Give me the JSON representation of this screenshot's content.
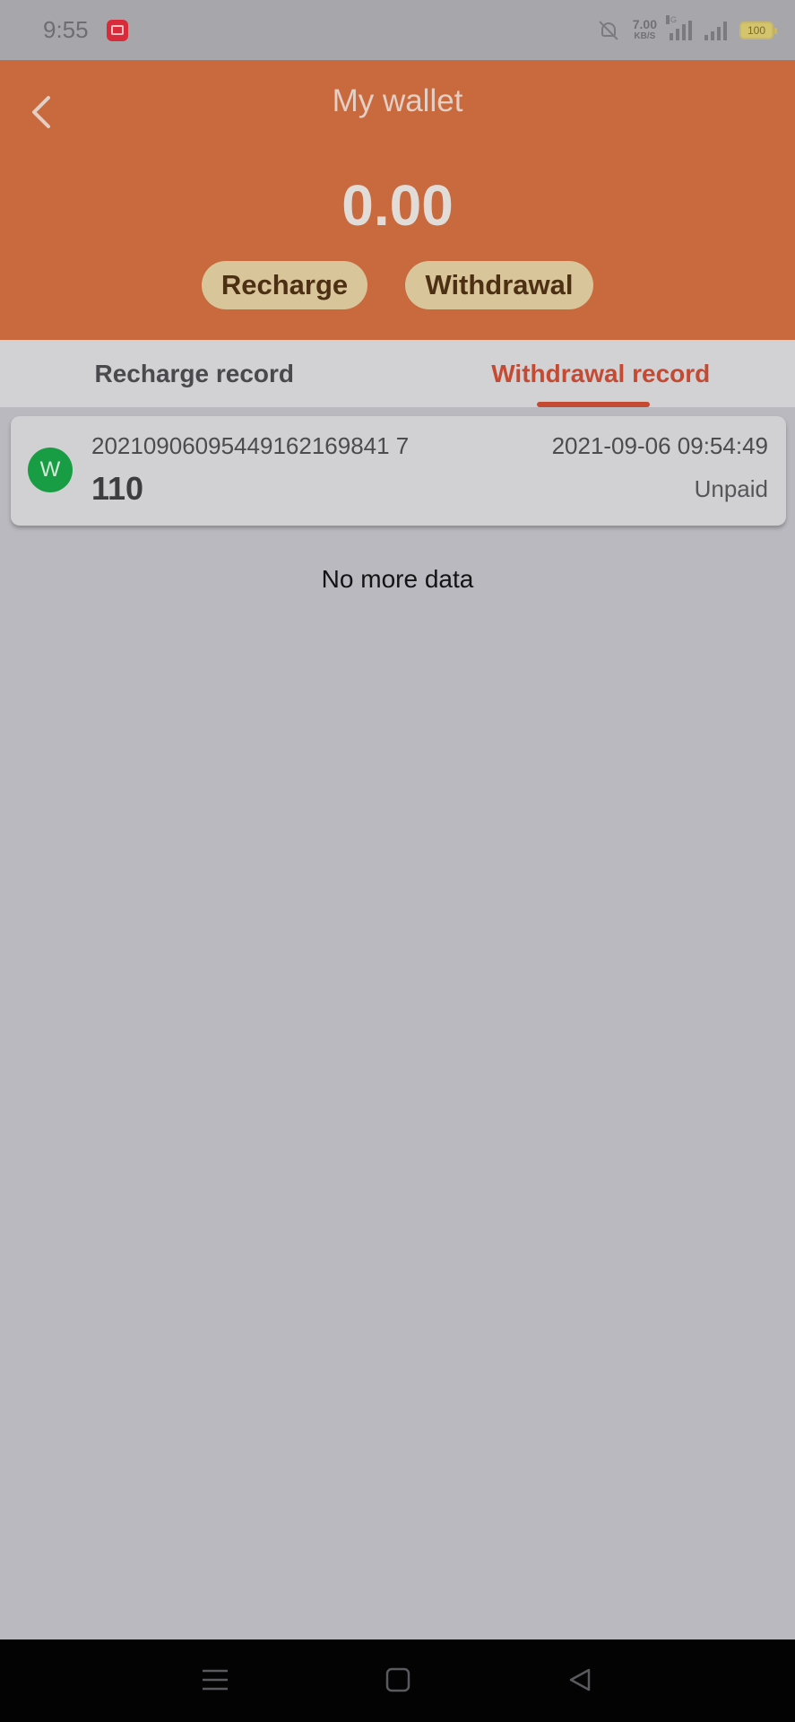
{
  "status_bar": {
    "time": "9:55",
    "net_speed": "7.00",
    "net_unit": "KB/S",
    "signal_tag": "4G",
    "battery": "100"
  },
  "header": {
    "title": "My wallet",
    "balance": "0.00",
    "recharge_label": "Recharge",
    "withdrawal_label": "Withdrawal"
  },
  "tabs": [
    {
      "label": "Recharge record",
      "active": false
    },
    {
      "label": "Withdrawal record",
      "active": true
    }
  ],
  "records": [
    {
      "avatar_letter": "W",
      "id": "20210906095449162169841 7",
      "time": "2021-09-06 09:54:49",
      "amount": "110",
      "status": "Unpaid"
    }
  ],
  "footer_text": "No more data",
  "colors": {
    "header_bg": "#c8693e",
    "pill_bg": "#d8c59a",
    "active_tab": "#c54a33",
    "avatar_bg": "#189d44"
  },
  "icons": {
    "back": "chevron-left-icon",
    "nav_menu": "menu-icon",
    "nav_home": "square-icon",
    "nav_back": "triangle-back-icon"
  }
}
